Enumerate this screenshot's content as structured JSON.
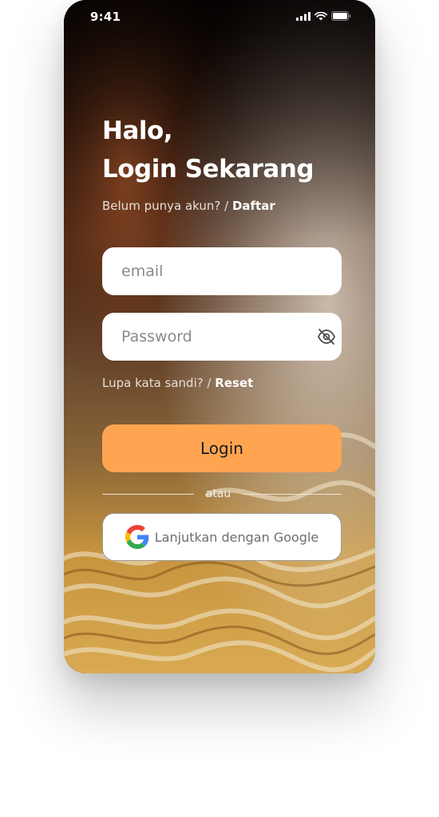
{
  "status_bar": {
    "time": "9:41"
  },
  "heading": {
    "line1": "Halo,",
    "line2": "Login Sekarang"
  },
  "register": {
    "prompt": "Belum punya akun? / ",
    "link": "Daftar"
  },
  "email_field": {
    "placeholder": "email",
    "value": ""
  },
  "password_field": {
    "placeholder": "Password",
    "value": ""
  },
  "forgot": {
    "prompt": "Lupa kata sandi? / ",
    "link": "Reset"
  },
  "login_button": {
    "label": "Login"
  },
  "divider": {
    "text": "atau"
  },
  "google_button": {
    "label": "Lanjutkan dengan Google"
  },
  "icons": {
    "signal": "signal-icon",
    "wifi": "wifi-icon",
    "battery": "battery-icon",
    "eye_off": "eye-off-icon",
    "google": "google-logo-icon"
  },
  "colors": {
    "accent": "#ffa552",
    "text_light": "#ffffff",
    "field_bg": "#ffffff"
  }
}
